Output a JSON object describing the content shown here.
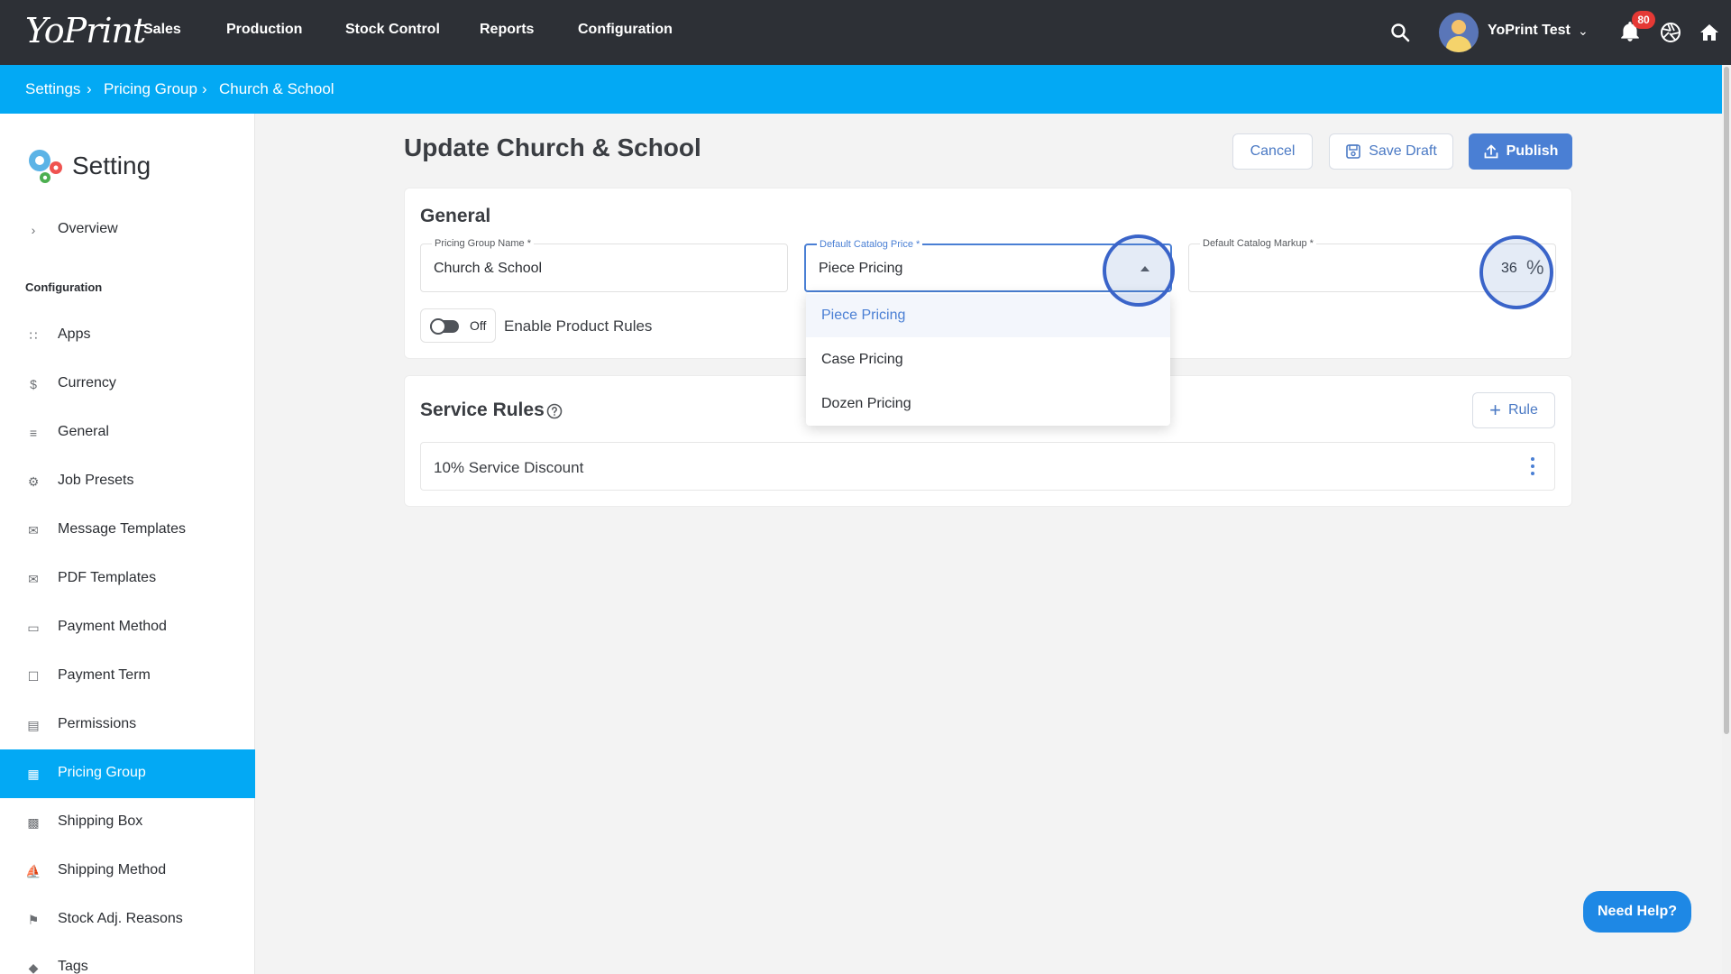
{
  "nav": {
    "logo": "YoPrint",
    "items": [
      "Sales",
      "Production",
      "Stock Control",
      "Reports",
      "Configuration"
    ],
    "user_name": "YoPrint Test",
    "notification_count": "80"
  },
  "breadcrumb": [
    "Settings",
    "Pricing Group",
    "Church & School"
  ],
  "sidebar": {
    "title": "Setting",
    "overview": "Overview",
    "section_label": "Configuration",
    "items": [
      {
        "label": "Apps",
        "icon": "grid-icon"
      },
      {
        "label": "Currency",
        "icon": "dollar-icon"
      },
      {
        "label": "General",
        "icon": "sliders-icon"
      },
      {
        "label": "Job Presets",
        "icon": "gear-icon"
      },
      {
        "label": "Message Templates",
        "icon": "mail-icon"
      },
      {
        "label": "PDF Templates",
        "icon": "mail-icon"
      },
      {
        "label": "Payment Method",
        "icon": "card-icon"
      },
      {
        "label": "Payment Term",
        "icon": "clipboard-icon"
      },
      {
        "label": "Permissions",
        "icon": "list-icon"
      },
      {
        "label": "Pricing Group",
        "icon": "calendar-icon",
        "active": true
      },
      {
        "label": "Shipping Box",
        "icon": "box-icon"
      },
      {
        "label": "Shipping Method",
        "icon": "ship-icon"
      },
      {
        "label": "Stock Adj. Reasons",
        "icon": "flag-icon"
      },
      {
        "label": "Tags",
        "icon": "tag-icon"
      }
    ]
  },
  "page": {
    "title": "Update Church & School",
    "cancel_label": "Cancel",
    "save_draft_label": "Save Draft",
    "publish_label": "Publish"
  },
  "general": {
    "title": "General",
    "pricing_group_name": {
      "label": "Pricing Group Name *",
      "value": "Church & School"
    },
    "default_catalog_price": {
      "label": "Default Catalog Price *",
      "value": "Piece Pricing"
    },
    "default_catalog_markup": {
      "label": "Default Catalog Markup *",
      "value": "36",
      "unit": "%"
    },
    "product_rules_toggle": {
      "state": "Off",
      "label": "Enable Product Rules"
    }
  },
  "dropdown": {
    "options": [
      "Piece Pricing",
      "Case Pricing",
      "Dozen Pricing"
    ],
    "selected": "Piece Pricing"
  },
  "service_rules": {
    "title": "Service Rules",
    "add_rule_label": "Rule",
    "rules": [
      "10% Service Discount"
    ]
  },
  "help": {
    "label": "Need Help?"
  },
  "colors": {
    "accent": "#03a9f4",
    "primary_button": "#4a7fd4",
    "topbar": "#2d3036",
    "badge": "#e53935"
  }
}
